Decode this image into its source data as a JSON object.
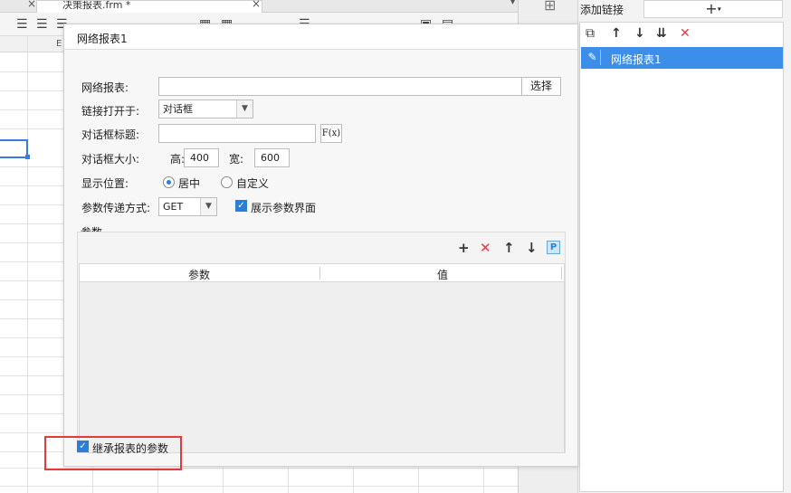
{
  "background_sheet": {
    "tab_label": "决策报表.frm *",
    "column_letter": "E"
  },
  "right_panel": {
    "title": "添加链接",
    "add_button": "+",
    "add_dropdown": "▾",
    "toolbar_icons": [
      "copy-icon",
      "arrow-up-icon",
      "arrow-down-icon",
      "sort-down-icon",
      "delete-icon"
    ],
    "items": [
      {
        "label": "网络报表1",
        "icon": "pencil-icon",
        "selected": true
      }
    ]
  },
  "dialog": {
    "title": "网络报表1",
    "report": {
      "label": "网络报表:",
      "value": "",
      "select_button": "选择"
    },
    "open_in": {
      "label": "链接打开于:",
      "selected": "对话框"
    },
    "dialog_title": {
      "label": "对话框标题:",
      "value": "",
      "formula_button": "F(x)"
    },
    "dialog_size": {
      "label": "对话框大小:",
      "height_label": "高:",
      "height_value": "400",
      "width_label": "宽:",
      "width_value": "600"
    },
    "position": {
      "label": "显示位置:",
      "options": [
        {
          "label": "居中",
          "selected": true
        },
        {
          "label": "自定义",
          "selected": false
        }
      ]
    },
    "param_method": {
      "label": "参数传递方式:",
      "selected": "GET",
      "show_params_label": "展示参数界面",
      "show_params_checked": true
    },
    "params": {
      "label": "参数",
      "toolbar_icons": [
        "add-icon",
        "delete-icon",
        "arrow-up-icon",
        "arrow-down-icon",
        "param-icon"
      ],
      "param_icon_letter": "P",
      "columns": [
        "参数",
        "值"
      ],
      "rows": []
    },
    "inherit": {
      "label": "继承报表的参数",
      "checked": true
    }
  },
  "colors": {
    "accent": "#2c7fd8",
    "selection": "#3c8ee9",
    "highlight_border": "#e23b3b",
    "delete_red": "#e23b3b",
    "param_icon_bg": "#cfe6f7"
  }
}
